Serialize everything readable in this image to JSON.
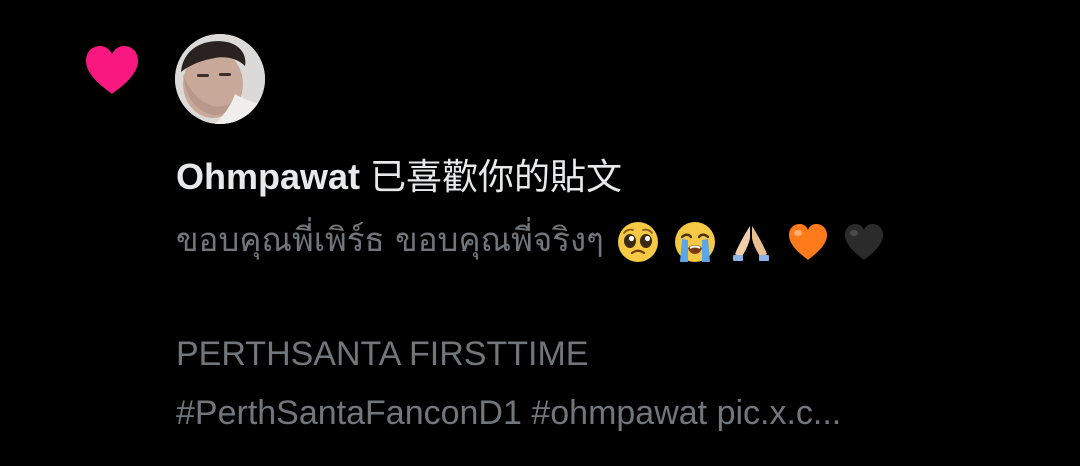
{
  "notification": {
    "type_icon": "heart-icon",
    "heart_color": "#f91880",
    "user_name": "Ohmpawat",
    "action_text": "已喜歡你的貼文",
    "post_text_line1": "ขอบคุณพี่เพิร์ธ ขอบคุณพี่จริงๆ",
    "emojis": [
      "pleading-face-icon",
      "loudly-crying-face-icon",
      "folded-hands-icon",
      "orange-heart-icon",
      "black-heart-icon"
    ],
    "post_text_line2": "PERTHSANTA FIRSTTIME",
    "post_text_line3": "#PerthSantaFanconD1 #ohmpawat pic.x.c..."
  },
  "colors": {
    "background": "#000000",
    "primary_text": "#e7e9ea",
    "secondary_text": "#71767b",
    "like_pink": "#f91880"
  }
}
